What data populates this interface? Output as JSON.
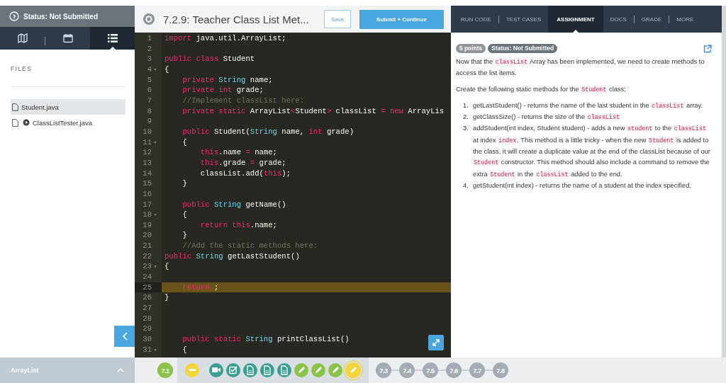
{
  "sidebar": {
    "status": "Status: Not Submitted",
    "view_tabs": [
      {
        "kind": "map",
        "selected": false
      },
      {
        "kind": "calendar",
        "selected": false
      },
      {
        "kind": "list",
        "selected": true
      }
    ],
    "files_heading": "FILES",
    "files": [
      {
        "name": "Student.java",
        "runnable": false,
        "selected": true
      },
      {
        "name": "ClassListTester.java",
        "runnable": true,
        "selected": false
      }
    ],
    "module": "ArrayList"
  },
  "editor": {
    "title": "7.2.9: Teacher Class List Met...",
    "save": "Save",
    "submit": "Submit + Continue",
    "lines": [
      {
        "number": "1",
        "foldable": false,
        "active": false,
        "tokens": [
          {
            "kind": "keyword",
            "s": "import"
          },
          {
            "kind": "plain",
            "s": " java.util.ArrayList;"
          }
        ]
      },
      {
        "number": "2",
        "foldable": false,
        "active": false
      },
      {
        "number": "3",
        "foldable": false,
        "active": false,
        "tokens": [
          {
            "kind": "keyword",
            "s": "public class"
          },
          {
            "kind": "plain",
            "s": " Student"
          }
        ]
      },
      {
        "number": "4",
        "foldable": true,
        "active": false,
        "tokens": [
          {
            "kind": "plain",
            "s": "{"
          }
        ]
      },
      {
        "number": "5",
        "foldable": false,
        "active": false,
        "tokens": [
          {
            "kind": "keyword",
            "s": "    private"
          },
          {
            "kind": "type",
            "s": " String"
          },
          {
            "kind": "plain",
            "s": " name;"
          }
        ]
      },
      {
        "number": "6",
        "foldable": false,
        "active": false,
        "tokens": [
          {
            "kind": "keyword",
            "s": "    private int"
          },
          {
            "kind": "plain",
            "s": " grade;"
          }
        ]
      },
      {
        "number": "7",
        "foldable": false,
        "active": false,
        "tokens": [
          {
            "kind": "comment",
            "s": "    //Implement classList here:"
          }
        ]
      },
      {
        "number": "8",
        "foldable": false,
        "active": false,
        "tokens": [
          {
            "kind": "keyword",
            "s": "    private static"
          },
          {
            "kind": "plain",
            "s": " ArrayList"
          },
          {
            "kind": "keyword",
            "s": "<"
          },
          {
            "kind": "plain",
            "s": "Student"
          },
          {
            "kind": "keyword",
            "s": ">"
          },
          {
            "kind": "plain",
            "s": " classList "
          },
          {
            "kind": "keyword",
            "s": "="
          },
          {
            "kind": "keyword",
            "s": " new"
          },
          {
            "kind": "plain",
            "s": " ArrayLis"
          }
        ]
      },
      {
        "number": "9",
        "foldable": false,
        "active": false
      },
      {
        "number": "10",
        "foldable": false,
        "active": false,
        "tokens": [
          {
            "kind": "keyword",
            "s": "    public"
          },
          {
            "kind": "plain",
            "s": " Student("
          },
          {
            "kind": "type",
            "s": "String"
          },
          {
            "kind": "plain",
            "s": " name, "
          },
          {
            "kind": "keyword",
            "s": "int"
          },
          {
            "kind": "plain",
            "s": " grade)"
          }
        ]
      },
      {
        "number": "11",
        "foldable": true,
        "active": false,
        "tokens": [
          {
            "kind": "plain",
            "s": "    {"
          }
        ]
      },
      {
        "number": "12",
        "foldable": false,
        "active": false,
        "tokens": [
          {
            "kind": "keyword",
            "s": "        this"
          },
          {
            "kind": "plain",
            "s": ".name "
          },
          {
            "kind": "keyword",
            "s": "="
          },
          {
            "kind": "plain",
            "s": " name;"
          }
        ]
      },
      {
        "number": "13",
        "foldable": false,
        "active": false,
        "tokens": [
          {
            "kind": "keyword",
            "s": "        this"
          },
          {
            "kind": "plain",
            "s": ".grade "
          },
          {
            "kind": "keyword",
            "s": "="
          },
          {
            "kind": "plain",
            "s": " grade;"
          }
        ]
      },
      {
        "number": "14",
        "foldable": false,
        "active": false,
        "tokens": [
          {
            "kind": "plain",
            "s": "        classList.add("
          },
          {
            "kind": "keyword",
            "s": "this"
          },
          {
            "kind": "plain",
            "s": ");"
          }
        ]
      },
      {
        "number": "15",
        "foldable": false,
        "active": false,
        "tokens": [
          {
            "kind": "plain",
            "s": "    }"
          }
        ]
      },
      {
        "number": "16",
        "foldable": false,
        "active": false
      },
      {
        "number": "17",
        "foldable": false,
        "active": false,
        "tokens": [
          {
            "kind": "keyword",
            "s": "    public"
          },
          {
            "kind": "type",
            "s": " String"
          },
          {
            "kind": "plain",
            "s": " getName()"
          }
        ]
      },
      {
        "number": "18",
        "foldable": true,
        "active": false,
        "tokens": [
          {
            "kind": "plain",
            "s": "    {"
          }
        ]
      },
      {
        "number": "19",
        "foldable": false,
        "active": false,
        "tokens": [
          {
            "kind": "keyword",
            "s": "        return this"
          },
          {
            "kind": "plain",
            "s": ".name;"
          }
        ]
      },
      {
        "number": "20",
        "foldable": false,
        "active": false,
        "tokens": [
          {
            "kind": "plain",
            "s": "    }"
          }
        ]
      },
      {
        "number": "21",
        "foldable": false,
        "active": false,
        "tokens": [
          {
            "kind": "comment",
            "s": "    //Add the static methods here:"
          }
        ]
      },
      {
        "number": "22",
        "foldable": false,
        "active": false,
        "tokens": [
          {
            "kind": "keyword",
            "s": "public"
          },
          {
            "kind": "type",
            "s": " String"
          },
          {
            "kind": "plain",
            "s": " getLastStudent()"
          }
        ]
      },
      {
        "number": "23",
        "foldable": true,
        "active": false,
        "tokens": [
          {
            "kind": "plain",
            "s": "{"
          }
        ]
      },
      {
        "number": "24",
        "foldable": false,
        "active": false
      },
      {
        "number": "25",
        "foldable": false,
        "active": true,
        "tokens": [
          {
            "kind": "keyword",
            "s": "    return"
          },
          {
            "kind": "plain",
            "s": " ;"
          }
        ]
      },
      {
        "number": "26",
        "foldable": false,
        "active": false,
        "tokens": [
          {
            "kind": "plain",
            "s": "}"
          }
        ]
      },
      {
        "number": "27",
        "foldable": false,
        "active": false
      },
      {
        "number": "28",
        "foldable": false,
        "active": false
      },
      {
        "number": "29",
        "foldable": false,
        "active": false
      },
      {
        "number": "30",
        "foldable": false,
        "active": false,
        "tokens": [
          {
            "kind": "keyword",
            "s": "    public static"
          },
          {
            "kind": "type",
            "s": " String"
          },
          {
            "kind": "plain",
            "s": " printClassList()"
          }
        ]
      },
      {
        "number": "31",
        "foldable": true,
        "active": false,
        "tokens": [
          {
            "kind": "plain",
            "s": "    {"
          }
        ]
      }
    ]
  },
  "panel": {
    "tabs": [
      {
        "label": "RUN CODE",
        "selected": false
      },
      {
        "label": "TEST CASES",
        "selected": false
      },
      {
        "label": "ASSIGNMENT",
        "selected": true
      },
      {
        "label": "DOCS",
        "selected": false
      },
      {
        "label": "GRADE",
        "selected": false
      },
      {
        "label": "MORE",
        "selected": false
      }
    ],
    "badges": [
      {
        "text": "5 points",
        "color": "#8e9499"
      },
      {
        "text": "Status: Not Submitted",
        "color": "#6b737b"
      }
    ],
    "paragraphs": [
      [
        {
          "kind": "text",
          "s": "Now that the "
        },
        {
          "kind": "code",
          "s": "classList"
        },
        {
          "kind": "text",
          "s": " Array has been implemented, we need to create methods to access the list items."
        }
      ],
      [
        {
          "kind": "text",
          "s": "Create the following static methods for the "
        },
        {
          "kind": "code",
          "s": "Student"
        },
        {
          "kind": "text",
          "s": " class:"
        }
      ]
    ],
    "steps": [
      {
        "number": "1.",
        "parts": [
          {
            "kind": "text",
            "s": "getLastStudent() - returns the name of the last student in the "
          },
          {
            "kind": "code",
            "s": "classList"
          },
          {
            "kind": "text",
            "s": " array."
          }
        ]
      },
      {
        "number": "2.",
        "parts": [
          {
            "kind": "text",
            "s": "getClassSize() - returns the size of the "
          },
          {
            "kind": "code",
            "s": "classList"
          }
        ]
      },
      {
        "number": "3.",
        "parts": [
          {
            "kind": "text",
            "s": "addStudent(int index, Student student) - adds a new "
          },
          {
            "kind": "code",
            "s": "student"
          },
          {
            "kind": "text",
            "s": " to the "
          },
          {
            "kind": "code",
            "s": "classList"
          },
          {
            "kind": "text",
            "s": " at index "
          },
          {
            "kind": "code",
            "s": "index"
          },
          {
            "kind": "text",
            "s": ". This method is a little tricky - when the new "
          },
          {
            "kind": "code",
            "s": "Student"
          },
          {
            "kind": "text",
            "s": " is added to the class, it will create a duplicate value at the end of the classList because of our "
          },
          {
            "kind": "code",
            "s": "Student"
          },
          {
            "kind": "text",
            "s": " constructor. This method should also include a command to remove the extra "
          },
          {
            "kind": "code",
            "s": "Student"
          },
          {
            "kind": "text",
            "s": " in the "
          },
          {
            "kind": "code",
            "s": "classList"
          },
          {
            "kind": "text",
            "s": " added to the end."
          }
        ]
      },
      {
        "number": "4.",
        "parts": [
          {
            "kind": "text",
            "s": "getStudent(int index) - returns the name of a student at the index specified."
          }
        ]
      }
    ]
  },
  "progress": [
    {
      "kind": "lesson",
      "label": "7.1",
      "color": "#8bc34a"
    },
    {
      "kind": "group",
      "activities": [
        {
          "kind": "minus",
          "color": "#f5d33b",
          "selected": false
        },
        {
          "kind": "video",
          "color": "#3a9e94",
          "selected": false
        },
        {
          "kind": "check",
          "color": "#3a9e94",
          "selected": false
        },
        {
          "kind": "doc",
          "color": "#3a9e94",
          "selected": false
        },
        {
          "kind": "doc",
          "color": "#3a9e94",
          "selected": false
        },
        {
          "kind": "doc",
          "color": "#3a9e94",
          "selected": false
        },
        {
          "kind": "pencil",
          "color": "#8bc34a",
          "selected": false
        },
        {
          "kind": "pencil",
          "color": "#8bc34a",
          "selected": false
        },
        {
          "kind": "pencil",
          "color": "#8bc34a",
          "selected": false
        },
        {
          "kind": "pencil",
          "color": "#f5d33b",
          "selected": true
        }
      ]
    },
    {
      "kind": "lesson",
      "label": "7.3",
      "color": "#a3acb4"
    },
    {
      "kind": "lesson",
      "label": "7.4",
      "color": "#a3acb4"
    },
    {
      "kind": "lesson",
      "label": "7.5",
      "color": "#a3acb4"
    },
    {
      "kind": "lesson",
      "label": "7.6",
      "color": "#a3acb4"
    },
    {
      "kind": "lesson",
      "label": "7.7",
      "color": "#a3acb4"
    },
    {
      "kind": "lesson",
      "label": "7.8",
      "color": "#a3acb4"
    }
  ]
}
